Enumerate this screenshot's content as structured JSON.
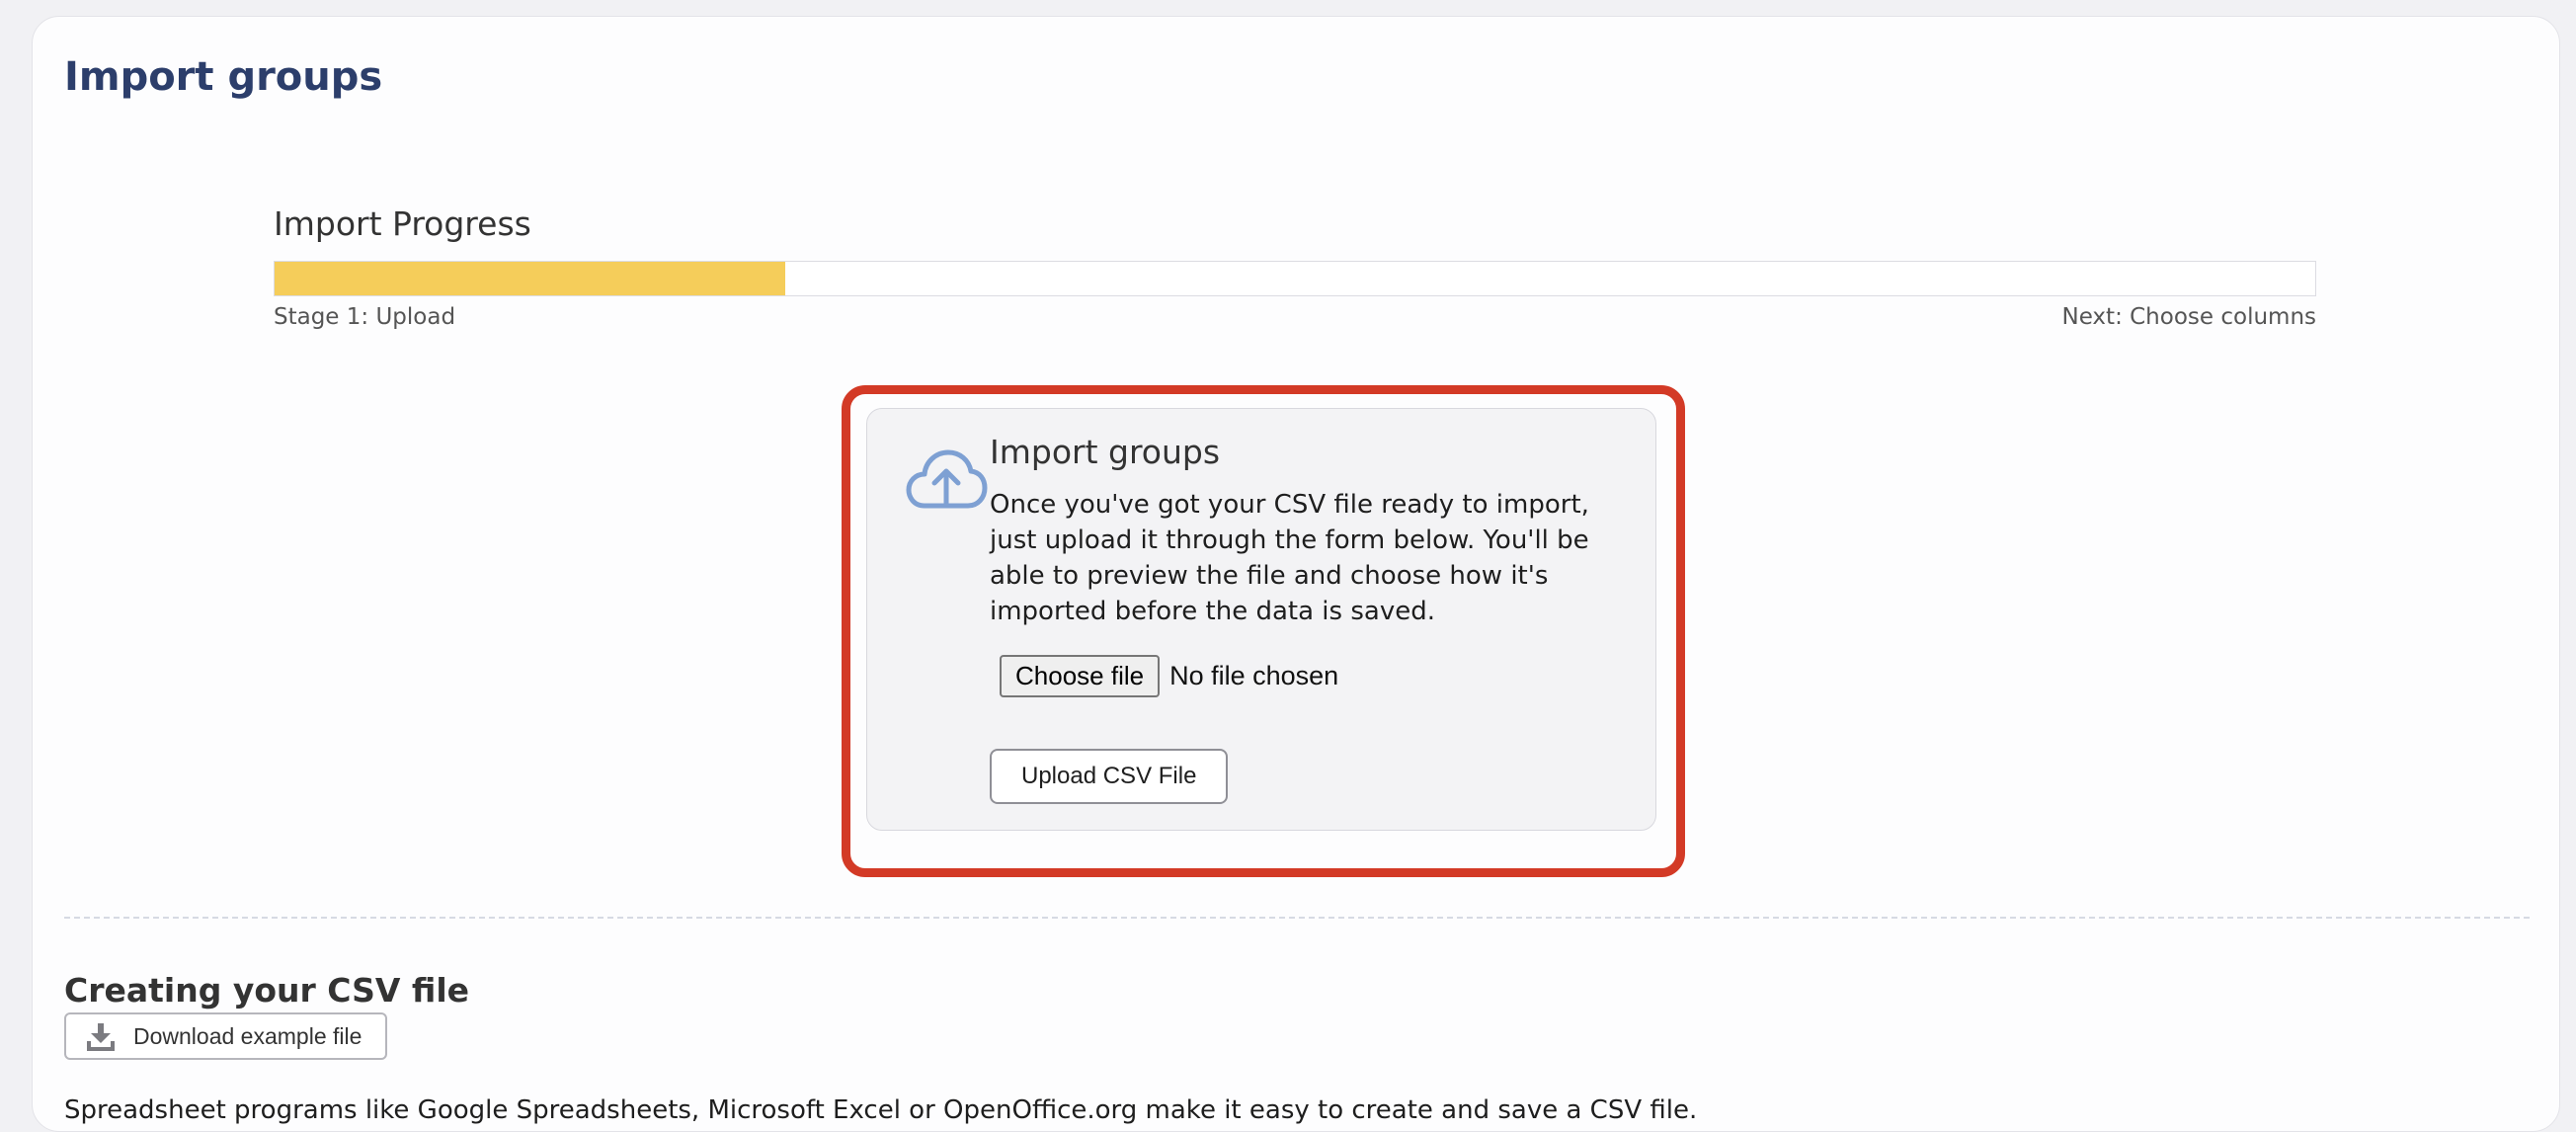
{
  "page": {
    "title": "Import groups"
  },
  "progress": {
    "title": "Import Progress",
    "fraction": 0.25,
    "stage_label": "Stage 1: Upload",
    "next_label": "Next: Choose columns",
    "fill_color": "#f5cd5a"
  },
  "upload": {
    "icon": "cloud-upload-icon",
    "title": "Import groups",
    "description": "Once you've got your CSV file ready to import, just upload it through the form below. You'll be able to preview the file and choose how it's imported before the data is saved.",
    "choose_file_label": "Choose file",
    "no_file_text": "No file chosen",
    "upload_button": "Upload CSV File",
    "highlight_color": "#d33a26"
  },
  "csv_section": {
    "title": "Creating your CSV file",
    "download_button": "Download example file",
    "download_icon": "download-icon",
    "body_text": "Spreadsheet programs like Google Spreadsheets, Microsoft Excel or OpenOffice.org make it easy to create and save a CSV file."
  }
}
